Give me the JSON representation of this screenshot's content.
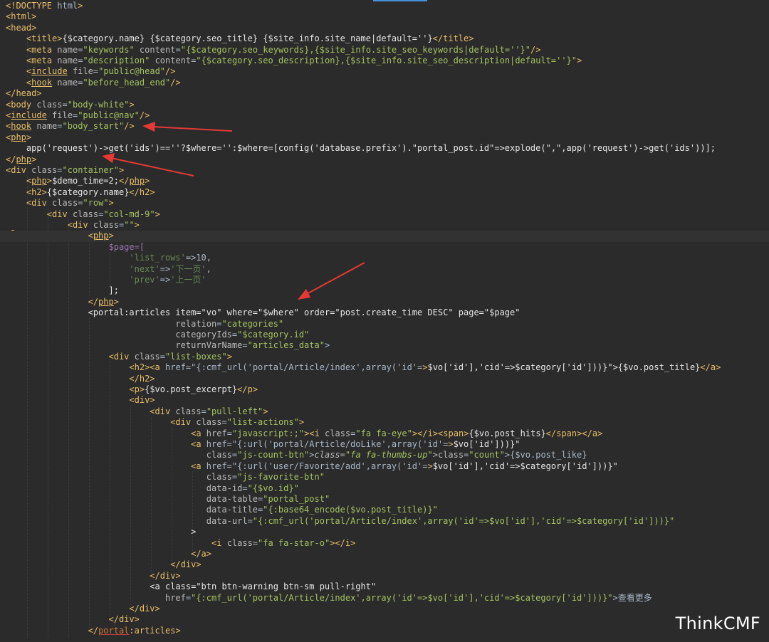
{
  "editor": {
    "lines": [
      "<!DOCTYPE html>",
      "<html>",
      "<head>",
      "    <title>{$category.name} {$category.seo_title} {$site_info.site_name|default=''}</title>",
      "    <meta name=\"keywords\" content=\"{$category.seo_keywords},{$site_info.site_seo_keywords|default=''}\"/>",
      "    <meta name=\"description\" content=\"{$category.seo_description},{$site_info.site_seo_description|default=''}\">",
      "    <include file=\"public@head\"/>",
      "    <hook name=\"before_head_end\"/>",
      "</head>",
      "<body class=\"body-white\">",
      "<include file=\"public@nav\"/>",
      "<hook name=\"body_start\"/>",
      "<php>",
      "    app('request')->get('ids')==''?$where='':$where=[config('database.prefix').\"portal_post.id\"=>explode(\",\",app('request')->get('ids'))];",
      "</php>",
      "<div class=\"container\">",
      "    <php>$demo_time=2;</php>",
      "    <h2>{$category.name}</h2>",
      "    <div class=\"row\">",
      "        <div class=\"col-md-9\">",
      "            <div class=\"\">",
      "                <php>",
      "                    $page=[",
      "                        'list_rows'=>10,",
      "                        'next'=>'下一页',",
      "                        'prev'=>'上一页'",
      "                    ];",
      "                </php>",
      "                <portal:articles item=\"vo\" where=\"$where\" order=\"post.create_time DESC\" page=\"$page\"",
      "                                 relation=\"categories\"",
      "                                 categoryIds=\"$category.id\"",
      "                                 returnVarName=\"articles_data\">",
      "                    <div class=\"list-boxes\">",
      "                        <h2><a href=\"{:cmf_url('portal/Article/index',array('id'=>$vo['id'],'cid'=>$category['id']))}\">{$vo.post_title}</a>",
      "                        </h2>",
      "                        <p>{$vo.post_excerpt}</p>",
      "                        <div>",
      "                            <div class=\"pull-left\">",
      "                                <div class=\"list-actions\">",
      "                                    <a href=\"javascript:;\"><i class=\"fa fa-eye\"></i><span>{$vo.post_hits}</span></a>",
      "                                    <a href=\"{:url('portal/Article/doLike',array('id'=>$vo['id']))}\"",
      "                                       class=\"js-count-btn\"><i class=\"fa fa-thumbs-up\"></i><span class=\"count\">{$vo.post_like}</span></a>",
      "                                    <a href=\"{:url('user/Favorite/add',array('id'=>$vo['id'],'cid'=>$category['id']))}\"",
      "                                       class=\"js-favorite-btn\"",
      "                                       data-id=\"{$vo.id}\"",
      "                                       data-table=\"portal_post\"",
      "                                       data-title=\"{:base64_encode($vo.post_title)}\"",
      "                                       data-url=\"{:cmf_url('portal/Article/index',array('id'=>$vo['id'],'cid'=>$category['id']))}\"",
      "                                    >",
      "                                        <i class=\"fa fa-star-o\"></i>",
      "                                    </a>",
      "                                </div>",
      "                            </div>",
      "                            <a class=\"btn btn-warning btn-sm pull-right\"",
      "                               href=\"{:cmf_url('portal/Article/index',array('id'=>$vo['id'],'cid'=>$category['id']))}\">查看更多</a>",
      "                        </div>",
      "                    </div>",
      "                </portal:articles>"
    ]
  },
  "watermark": "ThinkCMF",
  "colors": {
    "background": "#2b2b2b",
    "annotation_arrow": "#e53935"
  }
}
